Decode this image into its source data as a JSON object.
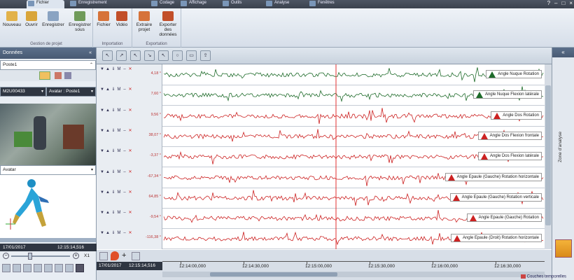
{
  "tabs": [
    {
      "label": "Fichier",
      "active": true
    },
    {
      "label": "Enregistrement"
    },
    {
      "label": "Codage"
    },
    {
      "label": "Affichage"
    },
    {
      "label": "Outils"
    },
    {
      "label": "Analyse"
    },
    {
      "label": "Fenêtres"
    }
  ],
  "window_controls": {
    "help": "?",
    "min": "–",
    "max": "□",
    "close": "×"
  },
  "ribbon": {
    "projet": {
      "label": "Gestion de projet",
      "buttons": [
        "Nouveau",
        "Ouvrir",
        "Enregistrer",
        "Enregistrer sous"
      ]
    },
    "import": {
      "label": "Importation",
      "buttons": [
        "Fichier",
        "Vidéo"
      ]
    },
    "export": {
      "label": "Exportation",
      "buttons": [
        "Extraire projet",
        "Exporter des données"
      ]
    }
  },
  "left": {
    "title": "Données",
    "collapse": "«",
    "poste_combo": "Poste1",
    "device_combo": "M2U00433",
    "avatar_combo": "Avatar : Poste1",
    "avatar_label": "Avatar",
    "date": "17/01/2017",
    "time": "12:15:14,516",
    "speed": "X1"
  },
  "tracks": [
    {
      "value": "4,18 °",
      "label": "Angle Nuque Rotation",
      "color": "#1e6b2a"
    },
    {
      "value": "7,60 °",
      "label": "Angle Nuque Flexion latérale",
      "color": "#1e6b2a"
    },
    {
      "value": "9,56 °",
      "label": "Angle Dos Rotation",
      "color": "#c22"
    },
    {
      "value": "38,07 °",
      "label": "Angle Dos Flexion frontale",
      "color": "#c22"
    },
    {
      "value": "-3,37 °",
      "label": "Angle Dos Flexion latérale",
      "color": "#c22"
    },
    {
      "value": "-67,34 °",
      "label": "Angle Epaule (Gauche) Rotation horizontale",
      "color": "#c22"
    },
    {
      "value": "64,85 °",
      "label": "Angle Epaule (Gauche) Rotation verticale",
      "color": "#c22"
    },
    {
      "value": "-9,54 °",
      "label": "Angle Epaule (Gauche) Rotation",
      "color": "#c22"
    },
    {
      "value": "-116,38 °",
      "label": "Angle Epaule (Droit) Rotation horizontale",
      "color": "#c22"
    }
  ],
  "timeline": {
    "date": "17/01/2017",
    "time": "12:15:14,516",
    "ticks": [
      "12:14:00,000",
      "12:14:30,000",
      "12:15:00,000",
      "12:15:30,000",
      "12:16:00,000",
      "12:16:30,000"
    ]
  },
  "right": {
    "label": "Zone d'analyse",
    "collapse": "«"
  },
  "status": {
    "text": "Couches temporelles"
  }
}
